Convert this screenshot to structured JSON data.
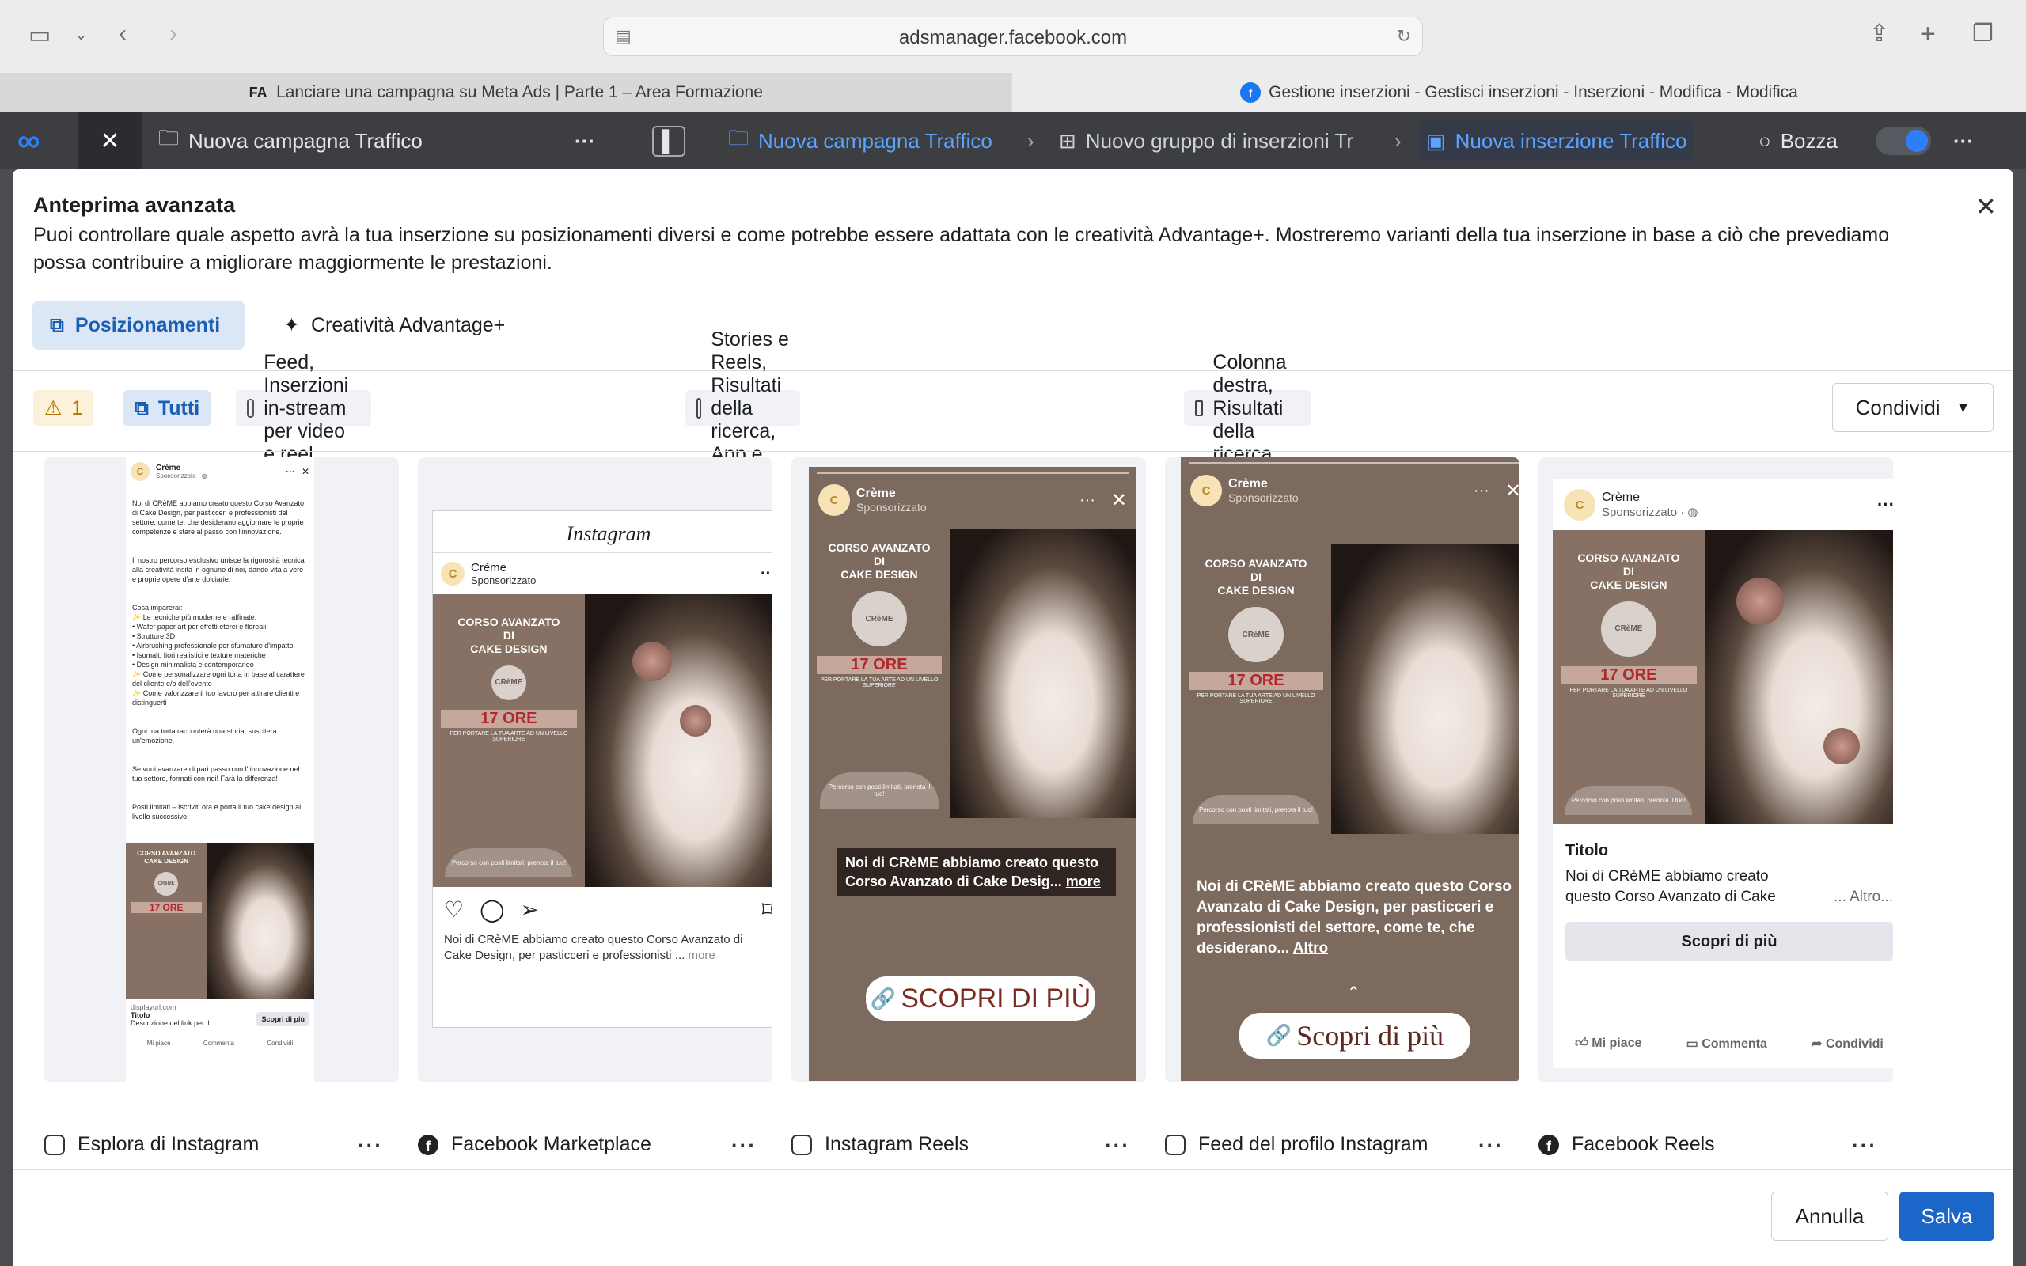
{
  "browser": {
    "url": "adsmanager.facebook.com",
    "tabs": [
      {
        "label": "Lanciare una campagna su Meta Ads | Parte 1 – Area Formazione",
        "favicon": "FA"
      },
      {
        "label": "Gestione inserzioni - Gestisci inserzioni - Inserzioni - Modifica - Modifica",
        "favicon": "f"
      }
    ]
  },
  "ads_bar": {
    "campaign_left": "Nuova campagna Traffico",
    "breadcrumb": [
      "Nuova campagna Traffico",
      "Nuovo gruppo di inserzioni Tr",
      "Nuova inserzione Traffico"
    ],
    "status": "Bozza"
  },
  "modal": {
    "title": "Anteprima avanzata",
    "description": "Puoi controllare quale aspetto avrà la tua inserzione su posizionamenti diversi e come potrebbe essere adattata con le creatività Advantage+. Mostreremo varianti della tua inserzione in base a ciò che prevediamo possa contribuire a migliorare maggiormente le prestazioni.",
    "tabs": {
      "placements": "Posizionamenti",
      "advantage": "Creatività Advantage+"
    },
    "filters": {
      "warning_count": "1",
      "all": "Tutti",
      "feed": "Feed, Inserzioni in-stream per video e reel",
      "stories": "Stories e Reels, Risultati della ricerca, App e siti",
      "right_column": "Colonna destra, Risultati della ricerca"
    },
    "share_label": "Condividi",
    "cancel_label": "Annulla",
    "save_label": "Salva"
  },
  "ad": {
    "page_name": "Crème",
    "avatar_letter": "C",
    "sponsored": "Sponsorizzato",
    "sponsored_with_globe": "Sponsorizzato · ◍",
    "creative": {
      "title_line1": "CORSO AVANZATO",
      "title_line2": "DI",
      "title_line3": "CAKE DESIGN",
      "logo": "CRèME",
      "hours": "17 ORE",
      "subtitle": "PER PORTARE LA TUA ARTE AD UN LIVELLO SUPERIORE",
      "limited": "Percorso con posti limitati, prenota il tuo!"
    },
    "feed_post": {
      "p1": "Noi di CRèME abbiamo creato questo Corso Avanzato di Cake Design, per pasticceri e professionisti del settore, come te, che desiderano aggiornare le proprie competenze e stare al passo con l'innovazione.",
      "p2": "Il nostro percorso esclusivo unisce la rigorosità tecnica alla creatività insita in ognuno di noi, dando vita a vere e proprie opere d'arte dolciarie.",
      "p3": "Cosa imparerai:\n✨ Le tecniche più moderne e raffinate:\n• Wafer paper art per effetti eterei e floreali\n• Strutture 3D\n• Airbrushing professionale per sfumature d'impatto\n• Isomalt, fiori realistici e texture materiche\n• Design minimalista e contemporaneo\n✨ Come personalizzare ogni torta in base al carattere del cliente e/o dell'evento\n✨ Come valorizzare il tuo lavoro per attirare clienti e distinguerti",
      "p4": "Ogni tua torta racconterà una storia, suscitera un'emozione.",
      "p5": "Se vuoi avanzare di pari passo con l' innovazione nel tuo settore, formati con noi! Farà la differenza!",
      "p6": "Posti limitati – Iscriviti ora e porta il tuo cake design al livello successivo.",
      "display_url": "displayurl.com",
      "link_title": "Titolo",
      "link_desc": "Descrizione del link per il...",
      "cta": "Scopri di più",
      "like": "Mi piace",
      "comment": "Commenta",
      "share": "Condividi"
    },
    "instagram": {
      "logo": "Instagram",
      "caption": "Noi di CRèME abbiamo creato questo Corso Avanzato di Cake Design, per pasticceri e professionisti ...",
      "more": "more"
    },
    "reels": {
      "caption": "Noi di CRèME abbiamo creato questo Corso Avanzato di Cake Desig...",
      "more": "more",
      "cta": "SCOPRI DI PIÙ"
    },
    "profile_feed": {
      "caption": "Noi di CRèME abbiamo creato questo Corso Avanzato di Cake Design, per pasticceri e professionisti del settore, come te, che desiderano...",
      "more": "Altro",
      "cta": "Scopri di più"
    },
    "fb_reels": {
      "title": "Titolo",
      "caption": "Noi di CRèME abbiamo creato questo Corso Avanzato di Cake",
      "more": "... Altro...",
      "cta": "Scopri di più",
      "like": "Mi piace",
      "comment": "Commenta",
      "share": "Condividi"
    }
  },
  "placements": [
    {
      "label": "Esplora di Instagram",
      "icon": "instagram-icon"
    },
    {
      "label": "Facebook Marketplace",
      "icon": "facebook-icon"
    },
    {
      "label": "Instagram Reels",
      "icon": "instagram-icon"
    },
    {
      "label": "Feed del profilo Instagram",
      "icon": "instagram-icon"
    },
    {
      "label": "Facebook Reels",
      "icon": "facebook-icon"
    }
  ],
  "colors": {
    "accent": "#1b66c9",
    "active_bg": "#dbe7f5",
    "warning": "#b07400",
    "creative_bg": "#867164"
  }
}
